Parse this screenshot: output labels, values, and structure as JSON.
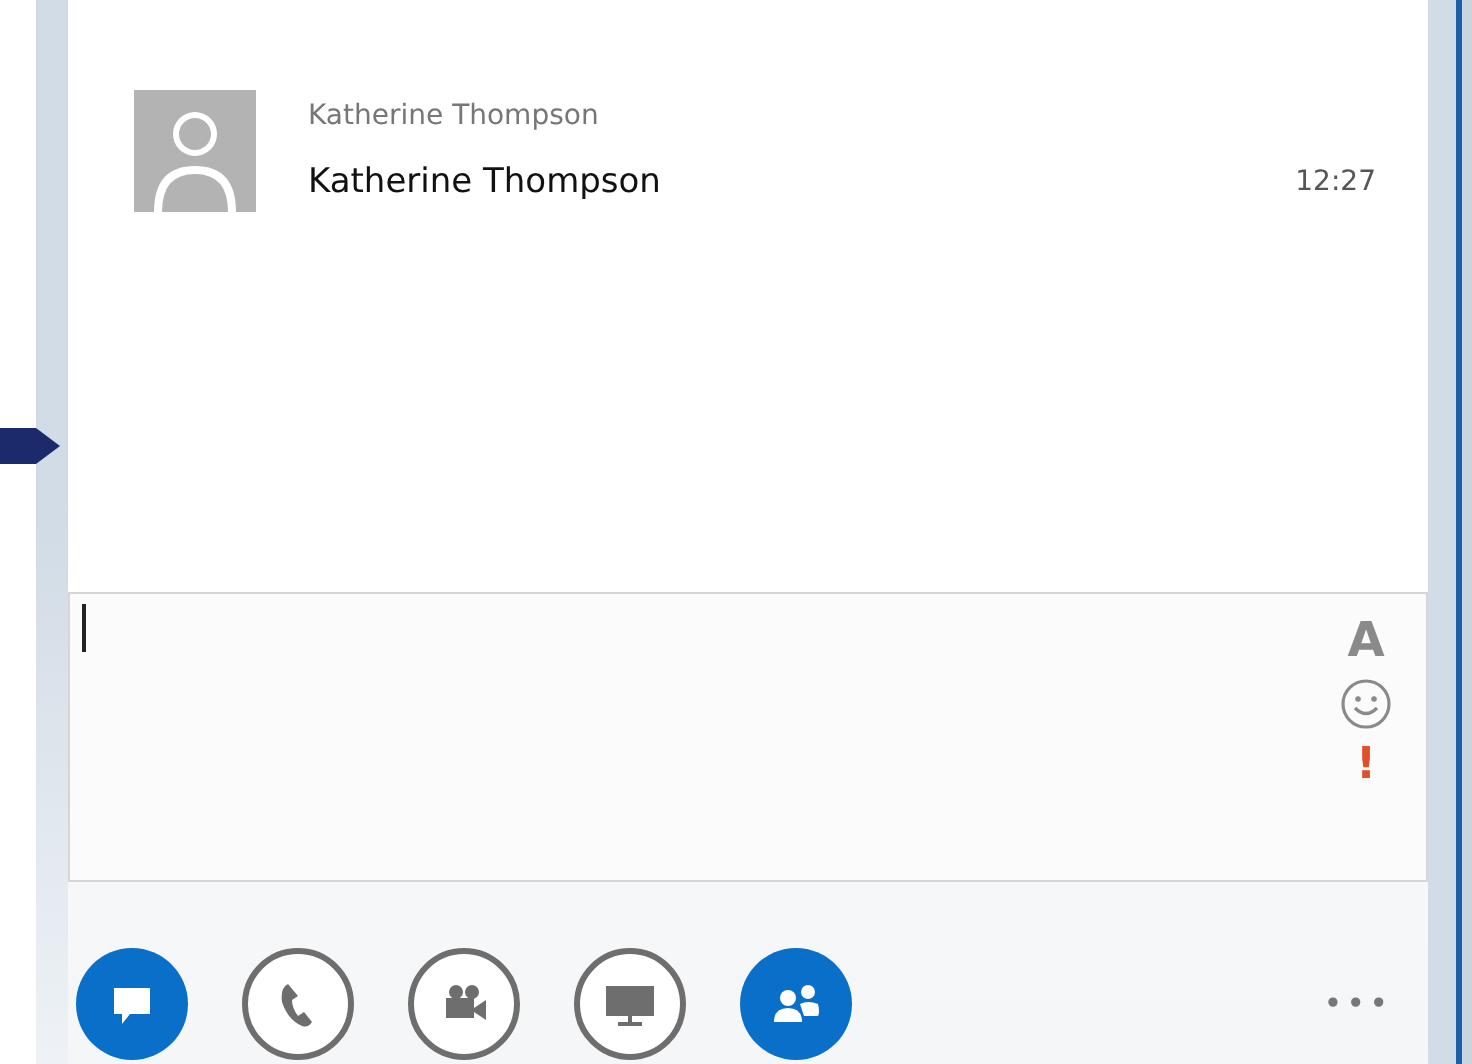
{
  "conversation": {
    "messages": [
      {
        "sender": "Katherine Thompson",
        "text": "Katherine Thompson",
        "time": "12:27"
      }
    ]
  },
  "compose": {
    "tools": [
      {
        "kind": "font",
        "label": "A"
      },
      {
        "kind": "emoticon"
      },
      {
        "kind": "importance",
        "label": "!"
      }
    ]
  },
  "actions": [
    {
      "kind": "chat",
      "active": true
    },
    {
      "kind": "call",
      "active": false
    },
    {
      "kind": "video",
      "active": false
    },
    {
      "kind": "present",
      "active": false
    },
    {
      "kind": "participants",
      "active": true
    }
  ],
  "more": {
    "label": "•••"
  }
}
